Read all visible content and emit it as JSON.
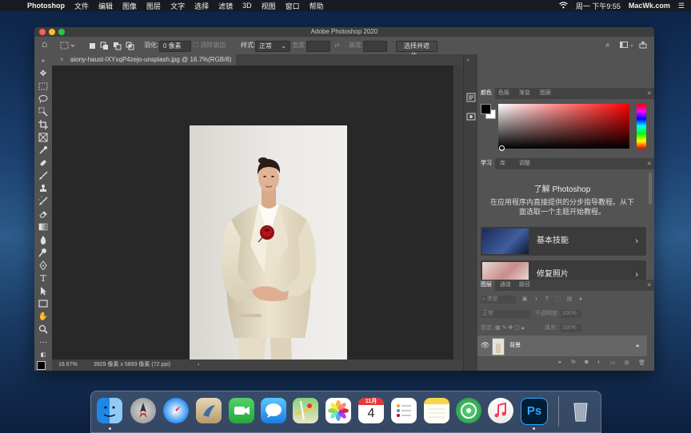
{
  "menubar": {
    "app_name": "Photoshop",
    "items": [
      "文件",
      "编辑",
      "图像",
      "图层",
      "文字",
      "选择",
      "滤镜",
      "3D",
      "视图",
      "窗口",
      "帮助"
    ],
    "clock": "周一 下午9:55",
    "brand": "MacWk.com"
  },
  "window": {
    "title": "Adobe Photoshop 2020"
  },
  "options": {
    "feather_label": "羽化:",
    "feather_value": "0 像素",
    "antialias_label": "消除锯齿",
    "style_label": "样式:",
    "style_value": "正常",
    "width_label": "宽度:",
    "height_label": "高度:",
    "select_mask_button": "选择并遮住..."
  },
  "document": {
    "tab_label": "aiony-haust-lXYxqP4zejo-unsplash.jpg @ 16.7%(RGB/8)",
    "zoom": "16.67%",
    "info": "3929 像素 x 5893 像素 (72 ppi)"
  },
  "color_panel": {
    "tabs": [
      "颜色",
      "色板",
      "渐变",
      "图案"
    ],
    "foreground": "#000000",
    "background": "#ffffff",
    "hue": "#ff0000"
  },
  "learn_panel": {
    "tabs": [
      "学习",
      "库",
      "调整"
    ],
    "heading": "了解 Photoshop",
    "description": "在应用程序内直接提供的分步指导教程。从下面选取一个主题开始教程。",
    "cards": [
      {
        "label": "基本技能"
      },
      {
        "label": "修复照片"
      }
    ]
  },
  "layers_panel": {
    "tabs": [
      "图层",
      "通道",
      "路径"
    ],
    "filter_kind": "类型",
    "blend_mode": "正常",
    "opacity_label": "不透明度:",
    "opacity_value": "100%",
    "lock_label": "锁定:",
    "fill_label": "填充:",
    "fill_value": "100%",
    "layer_name": "背景"
  },
  "calendar": {
    "month": "11月",
    "day": "4"
  },
  "dock": {
    "ps_label": "Ps"
  }
}
